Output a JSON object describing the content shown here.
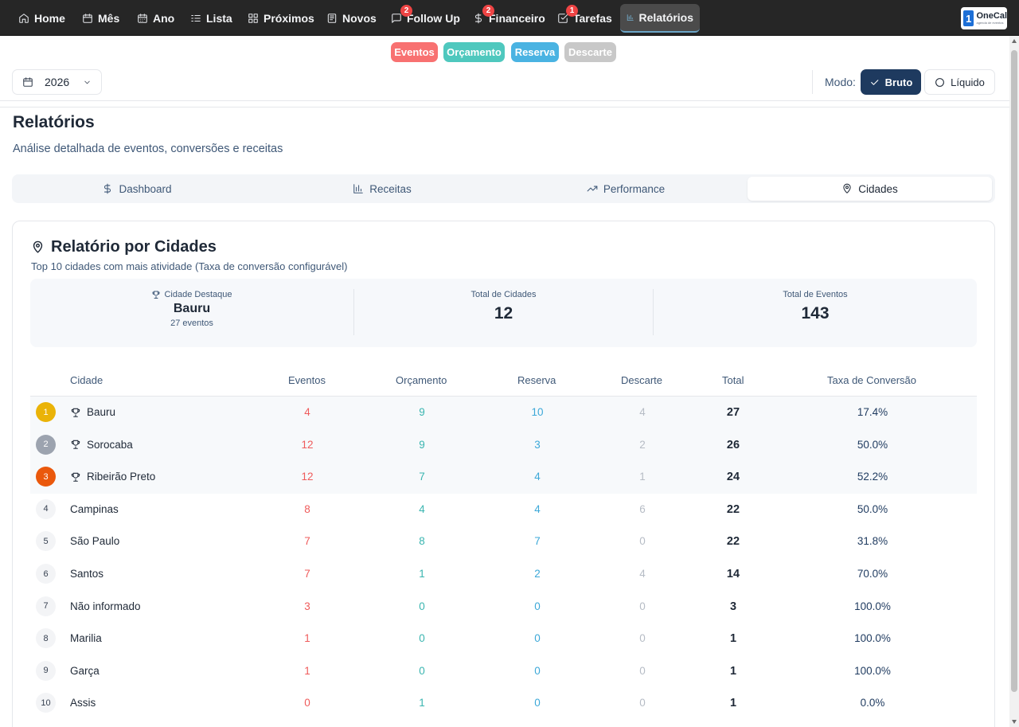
{
  "nav": {
    "items": [
      {
        "label": "Home",
        "icon": "home-icon"
      },
      {
        "label": "Mês",
        "icon": "calendar-icon"
      },
      {
        "label": "Ano",
        "icon": "calendar-days-icon"
      },
      {
        "label": "Lista",
        "icon": "list-icon"
      },
      {
        "label": "Próximos",
        "icon": "grid-icon"
      },
      {
        "label": "Novos",
        "icon": "newspaper-icon"
      },
      {
        "label": "Follow Up",
        "icon": "message-icon",
        "badge": "2"
      },
      {
        "label": "Financeiro",
        "icon": "dollar-icon",
        "badge": "2"
      },
      {
        "label": "Tarefas",
        "icon": "check-square-icon",
        "badge": "1"
      },
      {
        "label": "Relatórios",
        "icon": "bar-chart-icon",
        "active": true
      }
    ],
    "logo": {
      "mark": "1",
      "name": "OneCal",
      "tagline": "agenda de eventos"
    }
  },
  "legend": [
    {
      "label": "Eventos",
      "color": "#f87171"
    },
    {
      "label": "Orçamento",
      "color": "#4fc8be"
    },
    {
      "label": "Reserva",
      "color": "#4ab3e2"
    },
    {
      "label": "Descarte",
      "color": "#c8c8c8"
    }
  ],
  "toolbar": {
    "year": "2026",
    "mode_label": "Modo:",
    "mode_bruto": "Bruto",
    "mode_liquido": "Líquido"
  },
  "header": {
    "title": "Relatórios",
    "subtitle": "Análise detalhada de eventos, conversões e receitas"
  },
  "tabs": [
    {
      "label": "Dashboard",
      "icon": "dollar-icon"
    },
    {
      "label": "Receitas",
      "icon": "bar-chart-icon"
    },
    {
      "label": "Performance",
      "icon": "trending-up-icon"
    },
    {
      "label": "Cidades",
      "icon": "map-pin-icon",
      "active": true
    }
  ],
  "report": {
    "title": "Relatório por Cidades",
    "subtitle": "Top 10 cidades com mais atividade (Taxa de conversão configurável)",
    "summary": {
      "highlight_label": "Cidade Destaque",
      "highlight_city": "Bauru",
      "highlight_events": "27 eventos",
      "total_cities_label": "Total de Cidades",
      "total_cities": "12",
      "total_events_label": "Total de Eventos",
      "total_events": "143"
    },
    "columns": {
      "city": "Cidade",
      "eventos": "Eventos",
      "orcamento": "Orçamento",
      "reserva": "Reserva",
      "descarte": "Descarte",
      "total": "Total",
      "taxa": "Taxa de Conversão"
    },
    "rows": [
      {
        "rank": "1",
        "city": "Bauru",
        "eventos": "4",
        "orcamento": "9",
        "reserva": "10",
        "descarte": "4",
        "total": "27",
        "taxa": "17.4%",
        "trophy": true
      },
      {
        "rank": "2",
        "city": "Sorocaba",
        "eventos": "12",
        "orcamento": "9",
        "reserva": "3",
        "descarte": "2",
        "total": "26",
        "taxa": "50.0%",
        "trophy": true
      },
      {
        "rank": "3",
        "city": "Ribeirão Preto",
        "eventos": "12",
        "orcamento": "7",
        "reserva": "4",
        "descarte": "1",
        "total": "24",
        "taxa": "52.2%",
        "trophy": true
      },
      {
        "rank": "4",
        "city": "Campinas",
        "eventos": "8",
        "orcamento": "4",
        "reserva": "4",
        "descarte": "6",
        "total": "22",
        "taxa": "50.0%"
      },
      {
        "rank": "5",
        "city": "São Paulo",
        "eventos": "7",
        "orcamento": "8",
        "reserva": "7",
        "descarte": "0",
        "total": "22",
        "taxa": "31.8%"
      },
      {
        "rank": "6",
        "city": "Santos",
        "eventos": "7",
        "orcamento": "1",
        "reserva": "2",
        "descarte": "4",
        "total": "14",
        "taxa": "70.0%"
      },
      {
        "rank": "7",
        "city": "Não informado",
        "eventos": "3",
        "orcamento": "0",
        "reserva": "0",
        "descarte": "0",
        "total": "3",
        "taxa": "100.0%"
      },
      {
        "rank": "8",
        "city": "Marilia",
        "eventos": "1",
        "orcamento": "0",
        "reserva": "0",
        "descarte": "0",
        "total": "1",
        "taxa": "100.0%"
      },
      {
        "rank": "9",
        "city": "Garça",
        "eventos": "1",
        "orcamento": "0",
        "reserva": "0",
        "descarte": "0",
        "total": "1",
        "taxa": "100.0%"
      },
      {
        "rank": "10",
        "city": "Assis",
        "eventos": "0",
        "orcamento": "1",
        "reserva": "0",
        "descarte": "0",
        "total": "1",
        "taxa": "0.0%"
      }
    ]
  }
}
